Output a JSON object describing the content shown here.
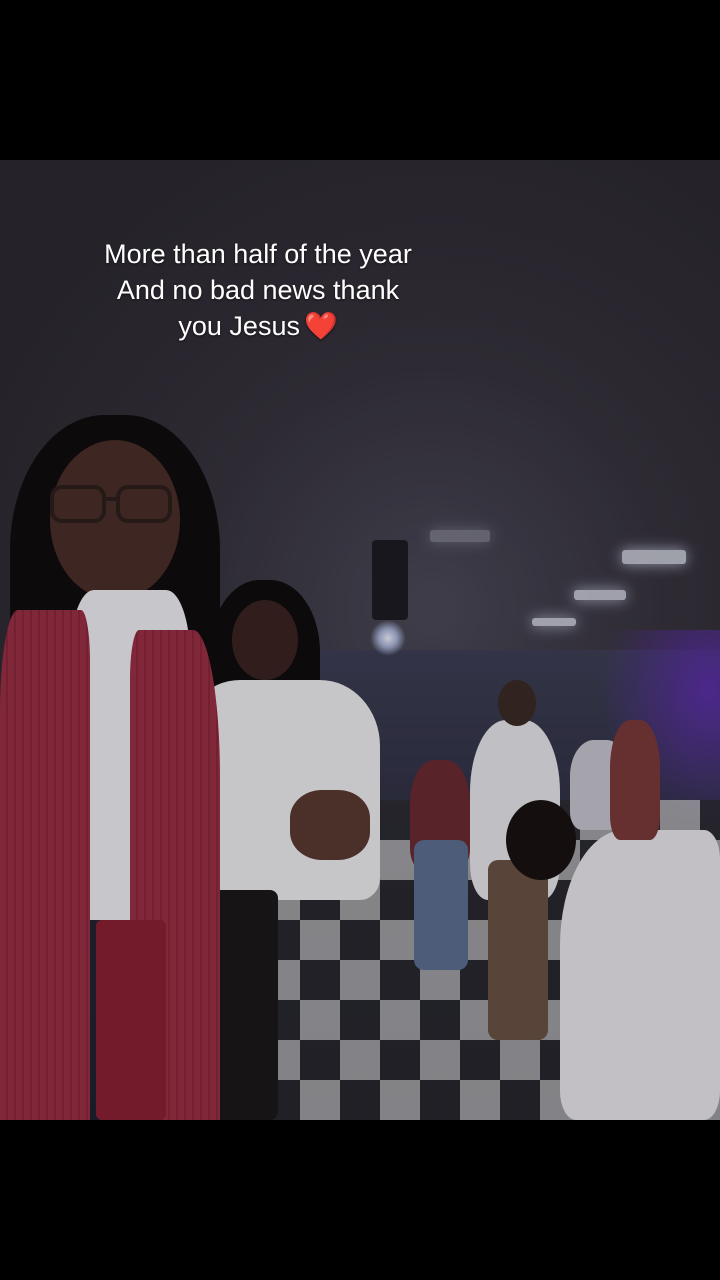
{
  "caption": {
    "line1": "More than half of the year",
    "line2": "And no bad news thank",
    "line3": "you Jesus",
    "emoji": "❤️"
  },
  "colors": {
    "letterbox": "#000000",
    "caption_text": "#ffffff",
    "heart": "#e0242c",
    "cardigan": "#9b2f45"
  }
}
